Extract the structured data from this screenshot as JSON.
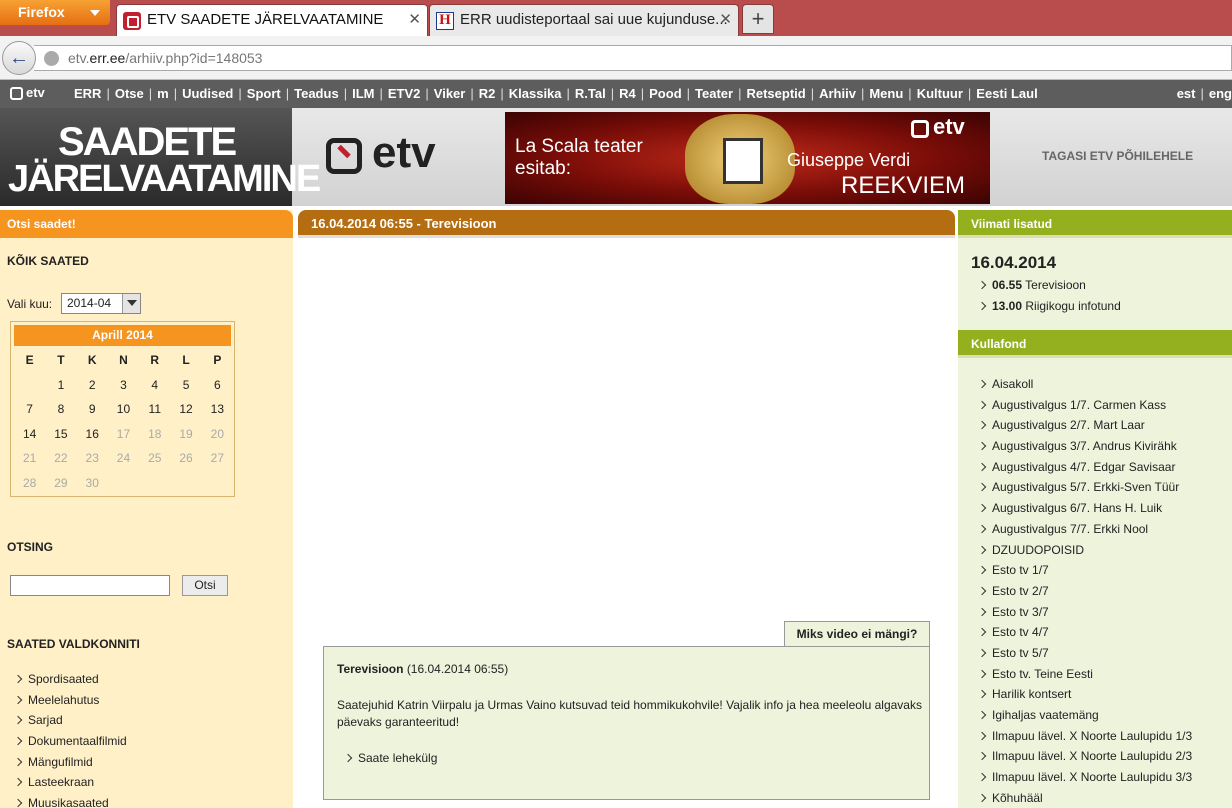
{
  "browser": {
    "app_button": "Firefox",
    "tabs": [
      {
        "title": "ETV SAADETE JÄRELVAATAMINE",
        "active": true
      },
      {
        "title": "ERR uudisteportaal sai uue kujunduse..."
      }
    ],
    "url_prefix": "etv.",
    "url_domain": "err.ee",
    "url_path": "/arhiiv.php?id=148053"
  },
  "sitenav": {
    "logo_text": "etv",
    "items": [
      "ERR",
      "Otse",
      "m",
      "Uudised",
      "Sport",
      "Teadus",
      "ILM",
      "ETV2",
      "Viker",
      "R2",
      "Klassika",
      "R.Tal",
      "R4",
      "Pood",
      "Teater",
      "Retseptid",
      "Arhiiv",
      "Menu",
      "Kultuur",
      "Eesti Laul"
    ],
    "lang": [
      "est",
      "eng"
    ]
  },
  "banner": {
    "title_line1": "SAADETE",
    "title_line2": "JÄRELVAATAMINE",
    "etv_logo": "etv",
    "promo_line1": "La Scala teater",
    "promo_line2": "esitab:",
    "promo_line3": "Giuseppe Verdi",
    "promo_line4": "REEKVIEM",
    "promo_logo": "etv",
    "back_link": "TAGASI ETV PÕHILEHELE"
  },
  "left": {
    "header": "Otsi saadet!",
    "all_shows": "KÕIK SAATED",
    "month_label": "Vali kuu:",
    "month_value": "2014-04",
    "calendar_title": "Aprill 2014",
    "weekdays": [
      "E",
      "T",
      "K",
      "N",
      "R",
      "L",
      "P"
    ],
    "weeks": [
      [
        "",
        "1",
        "2",
        "3",
        "4",
        "5",
        "6"
      ],
      [
        "7",
        "8",
        "9",
        "10",
        "11",
        "12",
        "13"
      ],
      [
        "14",
        "15",
        "16",
        "17",
        "18",
        "19",
        "20"
      ],
      [
        "21",
        "22",
        "23",
        "24",
        "25",
        "26",
        "27"
      ],
      [
        "28",
        "29",
        "30",
        "",
        "",
        "",
        ""
      ]
    ],
    "last_active_day": 16,
    "search_title": "OTSING",
    "search_button": "Otsi",
    "categories_title": "SAATED VALDKONNITI",
    "categories": [
      "Spordisaated",
      "Meelelahutus",
      "Sarjad",
      "Dokumentaalfilmid",
      "Mängufilmid",
      "Lasteekraan",
      "Muusikasaated"
    ]
  },
  "main": {
    "header": "16.04.2014 06:55 - Terevisioon",
    "why_video": "Miks video ei mängi?",
    "show_name": "Terevisioon",
    "show_time": "(16.04.2014 06:55)",
    "description": "Saatejuhid Katrin Viirpalu ja Urmas Vaino kutsuvad teid hommikukohvile! Vajalik info ja hea meeleolu algavaks päevaks garanteeritud!",
    "show_link": "Saate lehekülg"
  },
  "right": {
    "latest_header": "Viimati lisatud",
    "latest_date": "16.04.2014",
    "latest": [
      {
        "time": "06.55",
        "title": "Terevisioon"
      },
      {
        "time": "13.00",
        "title": "Riigikogu infotund"
      }
    ],
    "gold_header": "Kullafond",
    "gold_items": [
      "Aisakoll",
      "Augustivalgus 1/7. Carmen Kass",
      "Augustivalgus 2/7. Mart Laar",
      "Augustivalgus 3/7. Andrus Kivirähk",
      "Augustivalgus 4/7. Edgar Savisaar",
      "Augustivalgus 5/7. Erkki-Sven Tüür",
      "Augustivalgus 6/7. Hans H. Luik",
      "Augustivalgus 7/7. Erkki Nool",
      "DZUUDOPOISID",
      "Esto tv 1/7",
      "Esto tv 2/7",
      "Esto tv 3/7",
      "Esto tv 4/7",
      "Esto tv 5/7",
      "Esto tv. Teine Eesti",
      "Harilik kontsert",
      "Igihaljas vaatemäng",
      "Ilmapuu lävel. X Noorte Laulupidu 1/3",
      "Ilmapuu lävel. X Noorte Laulupidu 2/3",
      "Ilmapuu lävel. X Noorte Laulupidu 3/3",
      "Kõhuhääl"
    ]
  }
}
